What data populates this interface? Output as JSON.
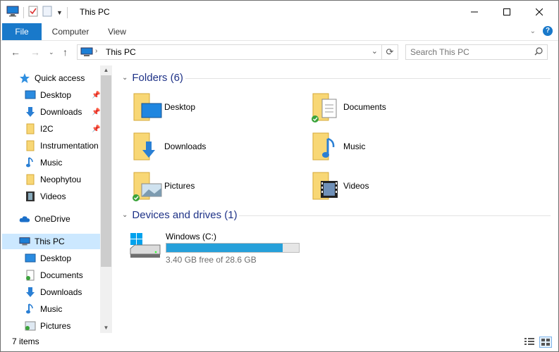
{
  "window": {
    "title": "This PC"
  },
  "ribbon": {
    "tabs": [
      "File",
      "Computer",
      "View"
    ]
  },
  "address": {
    "path": "This PC"
  },
  "search": {
    "placeholder": "Search This PC"
  },
  "nav": {
    "quick_access": "Quick access",
    "quick_items": [
      "Desktop",
      "Downloads",
      "I2C",
      "Instrumentation",
      "Music",
      "Neophytou",
      "Videos"
    ],
    "onedrive": "OneDrive",
    "this_pc": "This PC",
    "pc_items": [
      "Desktop",
      "Documents",
      "Downloads",
      "Music",
      "Pictures"
    ]
  },
  "folders": {
    "header": "Folders (6)",
    "items": [
      "Desktop",
      "Documents",
      "Downloads",
      "Music",
      "Pictures",
      "Videos"
    ]
  },
  "devices": {
    "header": "Devices and drives (1)",
    "drive_name": "Windows (C:)",
    "free_text": "3.40 GB free of 28.6 GB",
    "used_fraction": 0.88
  },
  "status": {
    "count": "7 items"
  },
  "colors": {
    "accent": "#1979ca",
    "header": "#1e3287",
    "selection": "#cce8ff",
    "drive_bar": "#26a0da",
    "folder": "#f8d775"
  }
}
